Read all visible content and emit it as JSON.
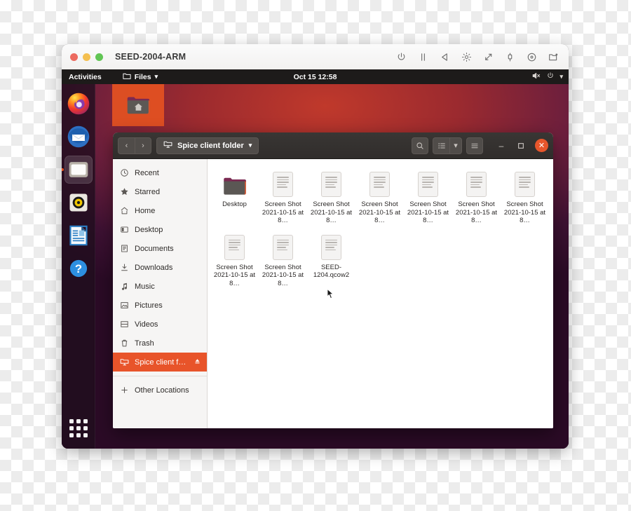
{
  "vm_window": {
    "title": "SEED-2004-ARM",
    "traffic_lights": [
      "close",
      "minimize",
      "zoom"
    ],
    "toolbar_icons": [
      {
        "name": "power-icon",
        "glyph": "power"
      },
      {
        "name": "pause-icon",
        "glyph": "pause"
      },
      {
        "name": "play-back-icon",
        "glyph": "play-back"
      },
      {
        "name": "brightness-icon",
        "glyph": "brightness"
      },
      {
        "name": "resize-icon",
        "glyph": "resize"
      },
      {
        "name": "usb-icon",
        "glyph": "usb"
      },
      {
        "name": "disc-icon",
        "glyph": "disc"
      },
      {
        "name": "shared-folder-icon",
        "glyph": "folder-share"
      }
    ]
  },
  "gnome_topbar": {
    "activities": "Activities",
    "app_menu": "Files",
    "app_menu_arrow": "▾",
    "clock": "Oct 15  12:58",
    "status_icons": [
      "volume-muted-icon",
      "power-icon",
      "chevron-down-icon"
    ]
  },
  "dock": {
    "items": [
      {
        "name": "firefox",
        "label": "Firefox",
        "active": false
      },
      {
        "name": "thunderbird",
        "label": "Thunderbird",
        "active": false
      },
      {
        "name": "files",
        "label": "Files",
        "active": true
      },
      {
        "name": "rhythmbox",
        "label": "Rhythmbox",
        "active": false
      },
      {
        "name": "libreoffice-impress",
        "label": "LibreOffice Impress",
        "active": false
      },
      {
        "name": "help",
        "label": "Help",
        "active": false
      }
    ],
    "app_grid_label": "Show Applications"
  },
  "desktop": {
    "icons": [
      {
        "name": "home-folder",
        "label": "",
        "selected": true
      }
    ]
  },
  "files_window": {
    "path_button": {
      "label": "Spice client folder",
      "arrow": "▾",
      "icon": "network-folder-icon"
    },
    "nav": {
      "back": "‹",
      "forward": "›"
    },
    "header_buttons": {
      "search": "search-icon",
      "view_list": "list-view-icon",
      "view_dropdown": "▾",
      "menu": "hamburger-menu-icon",
      "minimize": "–",
      "maximize": "▢",
      "close": "✕"
    },
    "sidebar": {
      "items": [
        {
          "label": "Recent",
          "icon": "clock-icon",
          "selected": false
        },
        {
          "label": "Starred",
          "icon": "star-icon",
          "selected": false
        },
        {
          "label": "Home",
          "icon": "home-icon",
          "selected": false
        },
        {
          "label": "Desktop",
          "icon": "desktop-icon",
          "selected": false
        },
        {
          "label": "Documents",
          "icon": "document-icon",
          "selected": false
        },
        {
          "label": "Downloads",
          "icon": "download-icon",
          "selected": false
        },
        {
          "label": "Music",
          "icon": "music-icon",
          "selected": false
        },
        {
          "label": "Pictures",
          "icon": "picture-icon",
          "selected": false
        },
        {
          "label": "Videos",
          "icon": "video-icon",
          "selected": false
        },
        {
          "label": "Trash",
          "icon": "trash-icon",
          "selected": false
        }
      ],
      "mounted": {
        "label": "Spice client f…",
        "icon": "network-folder-icon",
        "eject": "⏏",
        "selected": true
      },
      "other_locations": {
        "label": "Other Locations",
        "icon": "plus-icon"
      }
    },
    "files": [
      {
        "name": "Desktop",
        "type": "folder"
      },
      {
        "name": "Screen Shot 2021-10-15 at 8…",
        "type": "document"
      },
      {
        "name": "Screen Shot 2021-10-15 at 8…",
        "type": "document"
      },
      {
        "name": "Screen Shot 2021-10-15 at 8…",
        "type": "document"
      },
      {
        "name": "Screen Shot 2021-10-15 at 8…",
        "type": "document"
      },
      {
        "name": "Screen Shot 2021-10-15 at 8…",
        "type": "document"
      },
      {
        "name": "Screen Shot 2021-10-15 at 8…",
        "type": "document"
      },
      {
        "name": "Screen Shot 2021-10-15 at 8…",
        "type": "document"
      },
      {
        "name": "Screen Shot 2021-10-15 at 8…",
        "type": "document"
      },
      {
        "name": "SEED-1204.qcow2",
        "type": "document"
      }
    ]
  },
  "colors": {
    "ubuntu_orange": "#e8542a",
    "headerbar_dark": "#332f2d",
    "sidebar_bg": "#f6f5f4",
    "topbar_bg": "#1d1b1a"
  }
}
